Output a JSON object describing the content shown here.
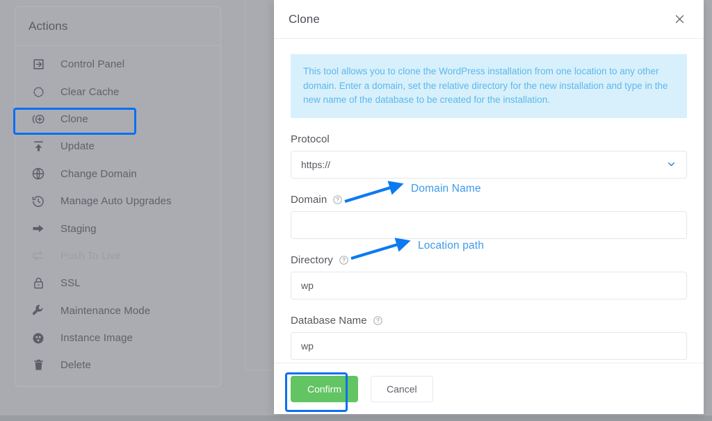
{
  "sidebar": {
    "header_title": "Actions",
    "items": [
      {
        "label": "Control Panel",
        "icon": "login-arrow-icon",
        "disabled": false
      },
      {
        "label": "Clear Cache",
        "icon": "refresh-dashed-icon",
        "disabled": false
      },
      {
        "label": "Clone",
        "icon": "clone-plus-icon",
        "disabled": false,
        "highlighted": true
      },
      {
        "label": "Update",
        "icon": "upload-arrow-icon",
        "disabled": false
      },
      {
        "label": "Change Domain",
        "icon": "globe-icon",
        "disabled": false
      },
      {
        "label": "Manage Auto Upgrades",
        "icon": "clock-history-icon",
        "disabled": false
      },
      {
        "label": "Staging",
        "icon": "arrow-right-icon",
        "disabled": false
      },
      {
        "label": "Push To Live",
        "icon": "swap-loop-icon",
        "disabled": true
      },
      {
        "label": "SSL",
        "icon": "lock-icon",
        "disabled": false
      },
      {
        "label": "Maintenance Mode",
        "icon": "wrench-icon",
        "disabled": false
      },
      {
        "label": "Instance Image",
        "icon": "film-reel-icon",
        "disabled": false
      },
      {
        "label": "Delete",
        "icon": "trash-icon",
        "disabled": false
      }
    ]
  },
  "modal": {
    "title": "Clone",
    "close_icon": "close-icon",
    "info_text": "This tool allows you to clone the WordPress installation from one location to any other domain. Enter a domain, set the relative directory for the new installation and type in the new name of the database to be created for the installation.",
    "fields": {
      "protocol": {
        "label": "Protocol",
        "value": "https://",
        "chevron_icon": "chevron-down-icon",
        "options": [
          "https://"
        ]
      },
      "domain": {
        "label": "Domain",
        "value": "",
        "placeholder": "",
        "help_icon": "question-circle-icon"
      },
      "directory": {
        "label": "Directory",
        "value": "wp",
        "placeholder": "",
        "help_icon": "question-circle-icon"
      },
      "database_name": {
        "label": "Database Name",
        "value": "wp",
        "placeholder": "",
        "help_icon": "question-circle-icon"
      }
    },
    "footer": {
      "confirm_label": "Confirm",
      "cancel_label": "Cancel"
    }
  },
  "annotations": {
    "domain_note": "Domain Name",
    "directory_note": "Location path",
    "accent_color": "#0b6ef5",
    "note_color": "#3d9ae8"
  },
  "colors": {
    "confirm_green": "#62c462",
    "info_bg": "#d8f0fb",
    "info_text": "#5cb8ed",
    "backdrop": "#a9abb0"
  }
}
